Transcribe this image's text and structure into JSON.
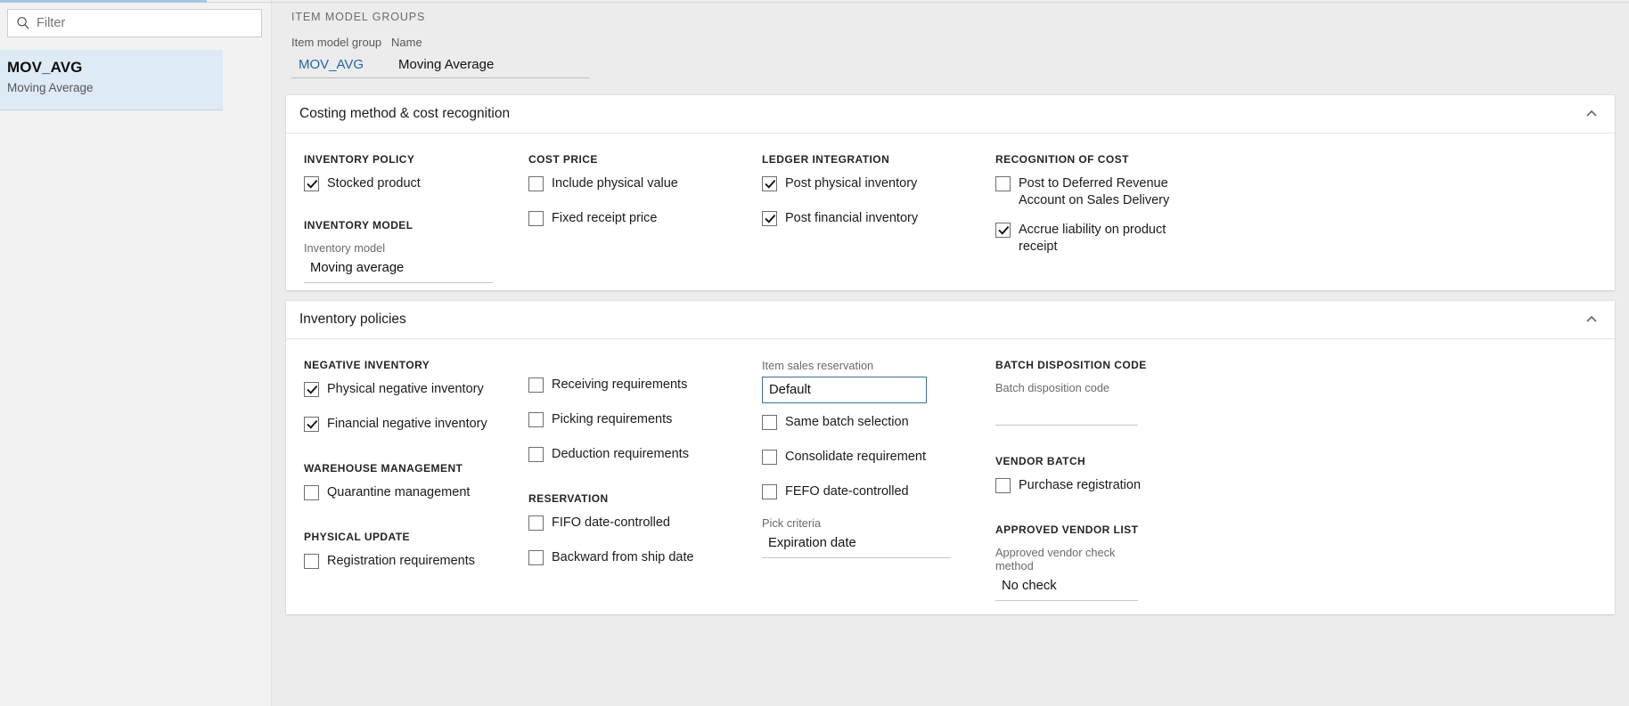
{
  "sidebar": {
    "filter": {
      "placeholder": "Filter",
      "value": "",
      "icon": "search-icon"
    },
    "items": [
      {
        "title": "MOV_AVG",
        "subtitle": "Moving Average",
        "selected": true
      }
    ]
  },
  "header": {
    "eyebrow": "ITEM MODEL GROUPS",
    "fields": [
      {
        "label": "Item model group",
        "value": "MOV_AVG",
        "is_link": true
      },
      {
        "label": "Name",
        "value": "Moving Average",
        "is_link": false
      }
    ]
  },
  "colors": {
    "accent_link": "#2266aa",
    "selection_bg": "#deeaf6",
    "focus_border": "#3b6f9e",
    "panel_bg": "#ffffff",
    "page_bg": "#ececec"
  },
  "panels": [
    {
      "title": "Costing method & cost recognition",
      "collapse_icon": "chevron-up-icon",
      "groups": [
        {
          "title": "INVENTORY POLICY",
          "checkboxes": [
            {
              "label": "Stocked product",
              "checked": true
            }
          ],
          "second_title": "INVENTORY MODEL",
          "second_field": {
            "label": "Inventory model",
            "value": "Moving average"
          }
        },
        {
          "title": "COST PRICE",
          "checkboxes": [
            {
              "label": "Include physical value",
              "checked": false
            },
            {
              "label": "Fixed receipt price",
              "checked": false
            }
          ]
        },
        {
          "title": "LEDGER INTEGRATION",
          "checkboxes": [
            {
              "label": "Post physical inventory",
              "checked": true
            },
            {
              "label": "Post financial inventory",
              "checked": true
            }
          ]
        },
        {
          "title": "RECOGNITION OF COST",
          "checkboxes": [
            {
              "label": "Post to Deferred Revenue Account on Sales Delivery",
              "checked": false
            },
            {
              "label": "Accrue liability on product receipt",
              "checked": true
            }
          ]
        }
      ]
    },
    {
      "title": "Inventory policies",
      "collapse_icon": "chevron-up-icon",
      "columns": [
        {
          "group1_title": "NEGATIVE INVENTORY",
          "group1_checkboxes": [
            {
              "label": "Physical negative inventory",
              "checked": true
            },
            {
              "label": "Financial negative inventory",
              "checked": true
            }
          ],
          "group2_title": "WAREHOUSE MANAGEMENT",
          "group2_checkboxes": [
            {
              "label": "Quarantine management",
              "checked": false
            }
          ],
          "group3_title": "PHYSICAL UPDATE",
          "group3_checkboxes": [
            {
              "label": "Registration requirements",
              "checked": false
            }
          ]
        },
        {
          "top_checkboxes": [
            {
              "label": "Receiving requirements",
              "checked": false
            },
            {
              "label": "Picking requirements",
              "checked": false
            },
            {
              "label": "Deduction requirements",
              "checked": false
            }
          ],
          "group_title": "RESERVATION",
          "group_checkboxes": [
            {
              "label": "FIFO date-controlled",
              "checked": false
            },
            {
              "label": "Backward from ship date",
              "checked": false
            }
          ]
        },
        {
          "field_top": {
            "label": "Item sales reservation",
            "value": "Default",
            "focused": true
          },
          "checkboxes": [
            {
              "label": "Same batch selection",
              "checked": false
            },
            {
              "label": "Consolidate requirement",
              "checked": false
            },
            {
              "label": "FEFO date-controlled",
              "checked": false
            }
          ],
          "field_bottom": {
            "label": "Pick criteria",
            "value": "Expiration date"
          }
        },
        {
          "group1_title": "BATCH DISPOSITION CODE",
          "field1": {
            "label": "Batch disposition code",
            "value": ""
          },
          "group2_title": "VENDOR BATCH",
          "group2_checkboxes": [
            {
              "label": "Purchase registration",
              "checked": false
            }
          ],
          "group3_title": "APPROVED VENDOR LIST",
          "field3": {
            "label": "Approved vendor check method",
            "value": "No check"
          }
        }
      ]
    }
  ]
}
